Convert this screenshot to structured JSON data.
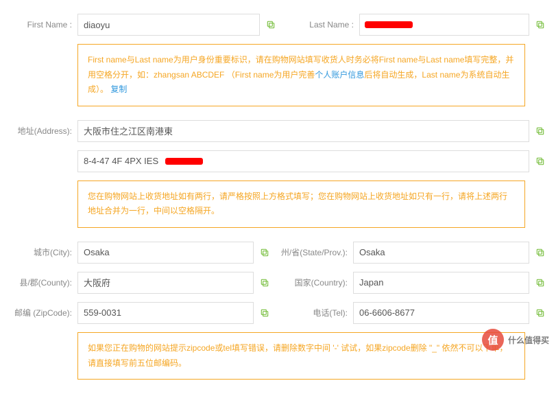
{
  "fields": {
    "firstName": {
      "label": "First Name :",
      "value": "diaoyu"
    },
    "lastName": {
      "label": "Last Name :",
      "value": ""
    },
    "address": {
      "label": "地址(Address):",
      "line1": "大阪市住之江区南港東",
      "line2": "8-4-47 4F 4PX IES "
    },
    "city": {
      "label": "城市(City):",
      "value": "Osaka"
    },
    "state": {
      "label": "州/省(State/Prov.):",
      "value": "Osaka"
    },
    "county": {
      "label": "县/郡(County):",
      "value": "大阪府"
    },
    "country": {
      "label": "国家(Country):",
      "value": "Japan"
    },
    "zipcode": {
      "label": "邮编 (ZipCode):",
      "value": "559-0031"
    },
    "tel": {
      "label": "电话(Tel):",
      "value": "06-6606-8677"
    }
  },
  "notices": {
    "name": {
      "part1": "First name与Last name为用户身份重要标识，请在购物网站填写收货人时务必将First name与Last name填写完整，并用空格分开，如：zhangsan ABCDEF （First name为用户完善",
      "link1": "个人账户信息",
      "part2": "后将自动生成，Last name为系统自动生成）。 ",
      "link2": "复制"
    },
    "address": "您在购物网站上收货地址如有两行，请严格按照上方格式填写；您在购物网站上收货地址如只有一行，请将上述两行地址合并为一行，中间以空格隔开。",
    "zipcode": "如果您正在购物的网站提示zipcode或tel填写错误，请删除数字中间 '-' 试试，如果zipcode删除 \"_\" 依然不可以下单，请直接填写前五位邮编码。"
  },
  "watermark": {
    "badge": "值",
    "text": "什么值得买"
  },
  "colors": {
    "accent": "#f5a623",
    "link": "#3399dd",
    "iconGreen": "#7bc043"
  }
}
